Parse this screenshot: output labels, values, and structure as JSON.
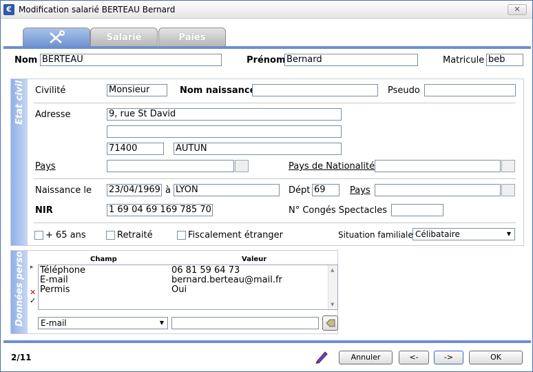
{
  "window": {
    "title": "Modification salarié BERTEAU Bernard",
    "close_label": "✕"
  },
  "tabs": [
    {
      "label": "",
      "icon": "scissors-icon",
      "active": true
    },
    {
      "label": "Salarié"
    },
    {
      "label": "Paies"
    }
  ],
  "header": {
    "nom_label": "Nom",
    "nom_value": "BERTEAU",
    "prenom_label": "Prénom",
    "prenom_value": "Bernard",
    "matricule_label": "Matricule",
    "matricule_value": "beb"
  },
  "etat_civil": {
    "section_label": "Etat civil",
    "civilite_label": "Civilité",
    "civilite_value": "Monsieur",
    "nom_naissance_label": "Nom naissance",
    "nom_naissance_value": "",
    "pseudo_label": "Pseudo",
    "pseudo_value": "",
    "adresse_label": "Adresse",
    "adresse1": "9, rue St David",
    "adresse2": "",
    "cp": "71400",
    "ville": "AUTUN",
    "pays_label": "Pays",
    "pays_value": "",
    "nationalite_label": "Pays de Nationalité",
    "nationalite_value": "",
    "naissance_label": "Naissance le",
    "naissance_date": "23/04/1969",
    "a_label": "à",
    "naissance_ville": "LYON",
    "dept_label": "Dépt",
    "dept_value": "69",
    "pays_naissance_label": "Pays",
    "pays_naissance_value": "",
    "nir_label": "NIR",
    "nir_value": "1 69 04 69 169 785 70",
    "conges_label": "N° Congés Spectacles",
    "conges_value": "",
    "plus65_label": "+ 65 ans",
    "retraite_label": "Retraité",
    "fiscal_label": "Fiscalement étranger",
    "situation_label": "Situation familiale",
    "situation_value": "Célibataire"
  },
  "donnees": {
    "section_label": "Données perso.",
    "col_champ": "Champ",
    "col_valeur": "Valeur",
    "rows": [
      {
        "champ": "Téléphone",
        "valeur": "06 81 59 64 73"
      },
      {
        "champ": "E-mail",
        "valeur": "bernard.berteau@mail.fr"
      },
      {
        "champ": "Permis",
        "valeur": "Oui"
      }
    ],
    "select_value": "E-mail",
    "input_value": ""
  },
  "footer": {
    "page": "2/11",
    "annuler": "Annuler",
    "prev": "<-",
    "next": "->",
    "ok": "OK"
  }
}
